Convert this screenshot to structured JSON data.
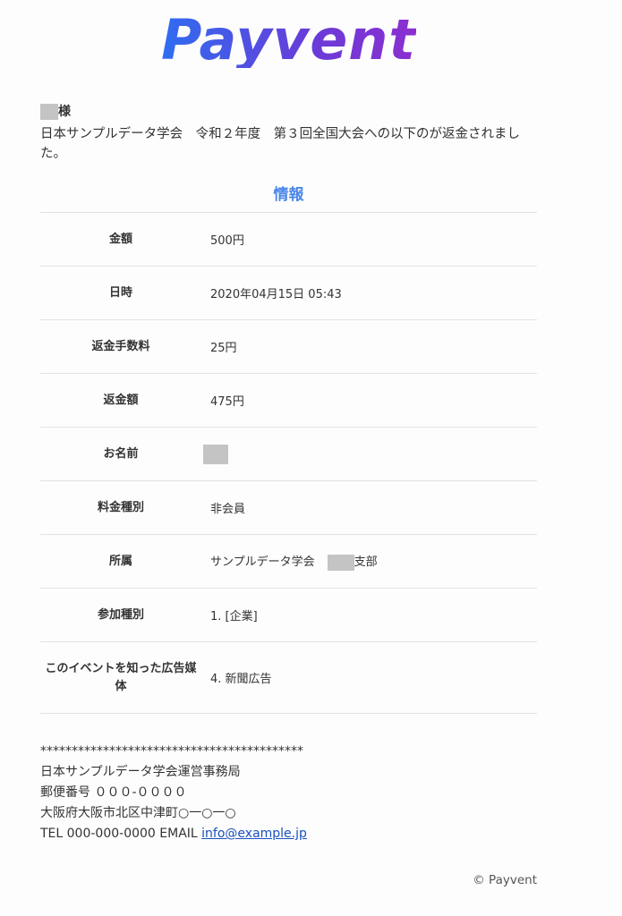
{
  "brand": {
    "logo_text": "Payvent"
  },
  "greeting": {
    "suffix": "様"
  },
  "intro": {
    "text": "日本サンプルデータ学会　令和２年度　第３回全国大会への以下のが返金されました。"
  },
  "section": {
    "title": "情報"
  },
  "details": [
    {
      "label": "金額",
      "value": "500円"
    },
    {
      "label": "日時",
      "value": "2020年04月15日 05:43"
    },
    {
      "label": "返金手数料",
      "value": "25円"
    },
    {
      "label": "返金額",
      "value": "475円"
    },
    {
      "label": "お名前",
      "value": ""
    },
    {
      "label": "料金種別",
      "value": "非会員"
    },
    {
      "label": "所属",
      "value": "サンプルデータ学会",
      "value_suffix": "支部"
    },
    {
      "label": "参加種別",
      "value": "1. [企業]"
    },
    {
      "label": "このイベントを知った広告媒体",
      "value": "4. 新聞広告"
    }
  ],
  "footer": {
    "separator": "******************************************",
    "org": "日本サンプルデータ学会運営事務局",
    "postal": "郵便番号 ０００-００００",
    "address": "大阪府大阪市北区中津町○一○一○",
    "contact_prefix": "TEL 000-000-0000 EMAIL ",
    "email": "info@example.jp"
  },
  "copyright": "© Payvent",
  "colors": {
    "accent": "#4a86e8",
    "link": "#1a4fbf",
    "redaction": "#c4c4c4"
  }
}
